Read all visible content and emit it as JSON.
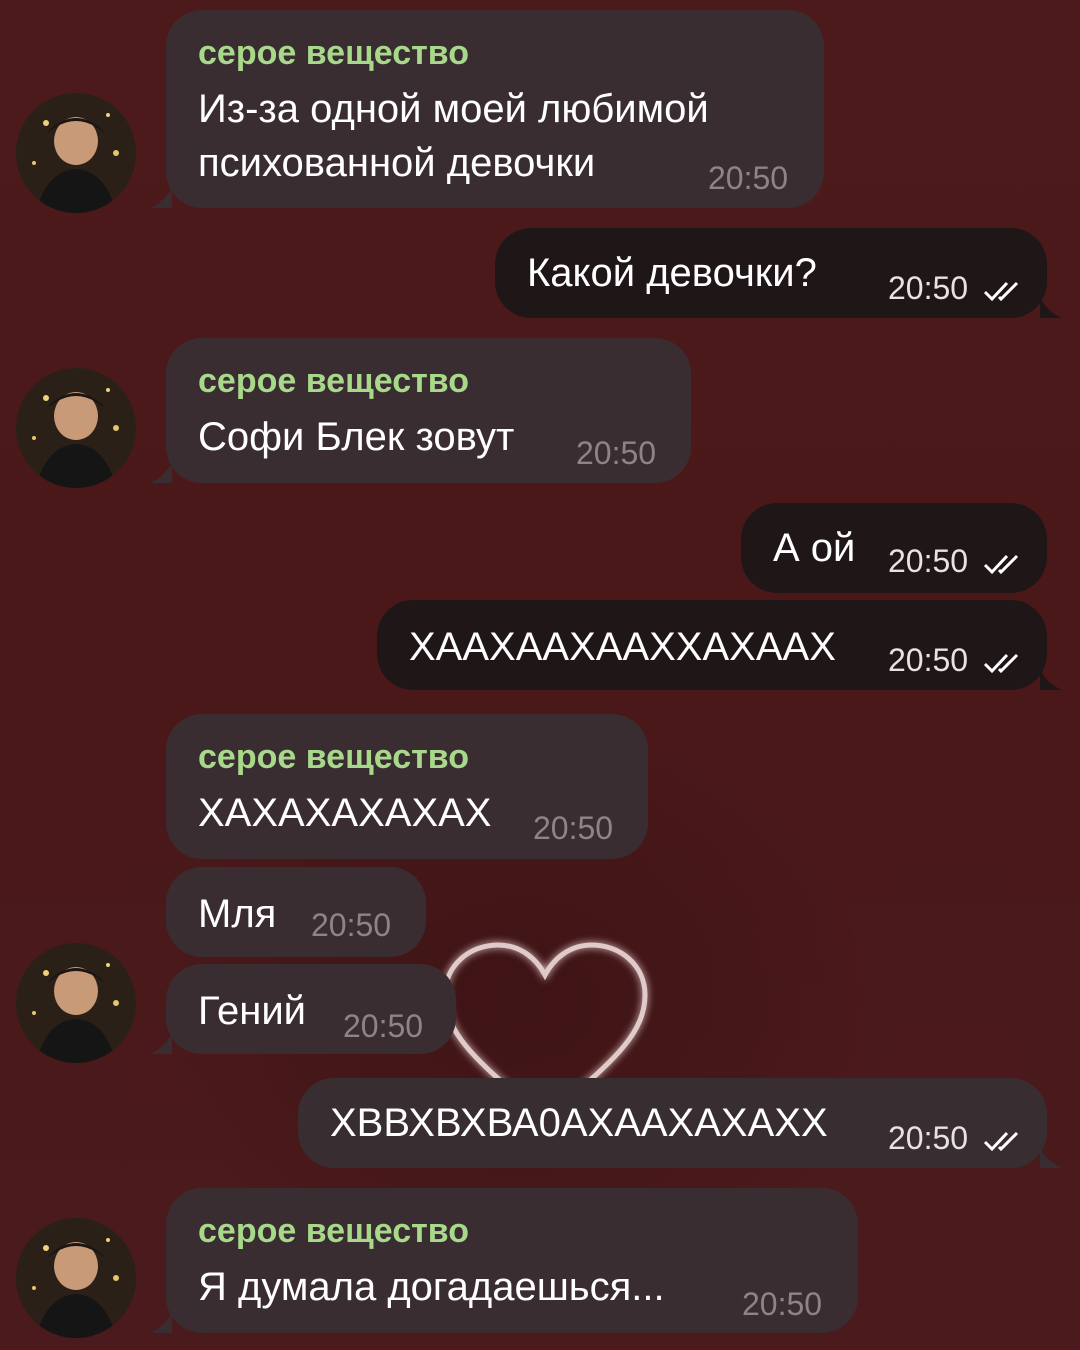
{
  "colors": {
    "background": "#4a1a1c",
    "incoming_bubble": "#3a2d31",
    "outgoing_bubble": "#1f1618",
    "sender_name": "#a8d98b",
    "timestamp_in": "#8e8387"
  },
  "messages": [
    {
      "sender": "серое вещество",
      "text_lines": [
        "Из-за одной моей любимой",
        "психованной девочки"
      ],
      "time": "20:50"
    },
    {
      "text": "Какой девочки?",
      "time": "20:50",
      "status": "read-check-icon"
    },
    {
      "sender": "серое вещество",
      "text": "Софи Блек зовут",
      "time": "20:50"
    },
    {
      "text": "А ой",
      "time": "20:50",
      "status": "read-check-icon"
    },
    {
      "text": "ХААХААХААХХАХААХ",
      "time": "20:50",
      "status": "read-check-icon"
    },
    {
      "sender": "серое вещество",
      "text": "ХАХАХАХАХАХ",
      "time": "20:50"
    },
    {
      "text": "Мля",
      "time": "20:50"
    },
    {
      "text": "Гений",
      "time": "20:50"
    },
    {
      "text": "ХВВХВХВА0АХААХАХАХХ",
      "time": "20:50",
      "status": "read-check-icon"
    },
    {
      "sender": "серое вещество",
      "text": "Я думала догадаешься...",
      "time": "20:50"
    }
  ]
}
